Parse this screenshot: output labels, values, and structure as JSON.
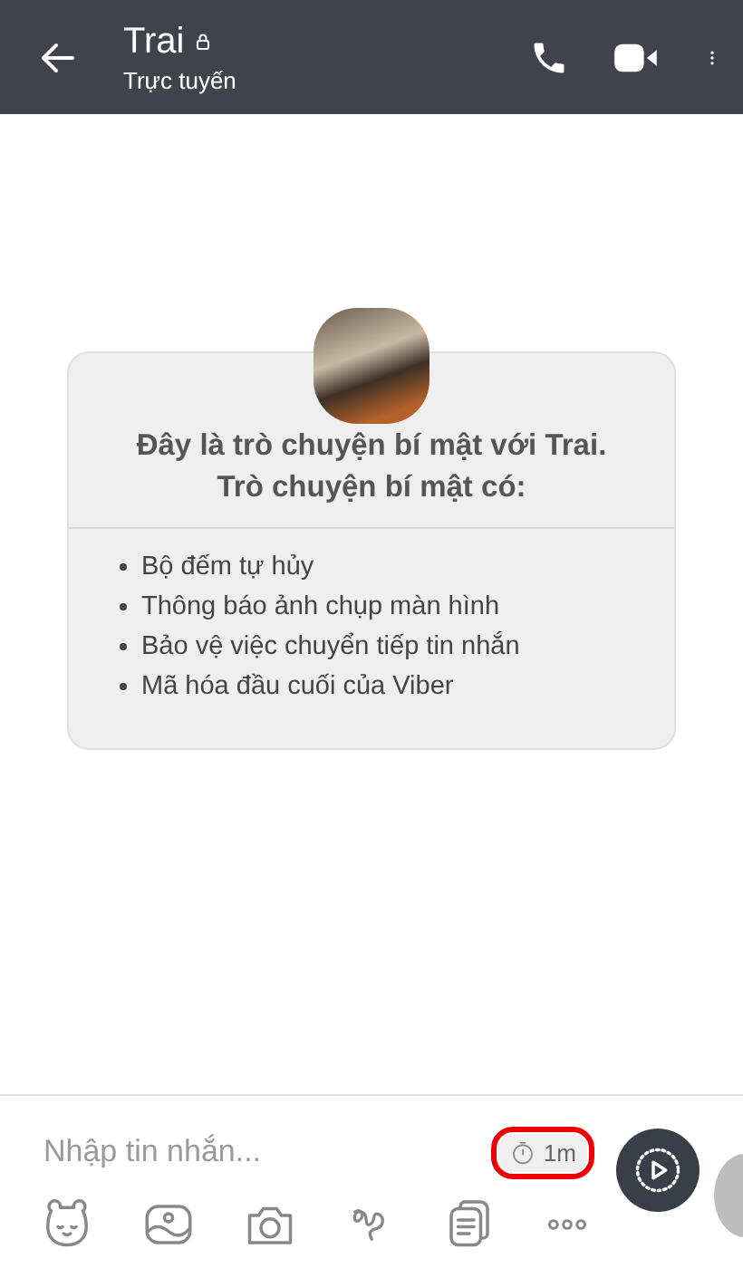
{
  "header": {
    "title": "Trai",
    "status": "Trực tuyến"
  },
  "intro": {
    "heading": "Đây là trò chuyện bí mật với Trai.\nTrò chuyện bí mật có:",
    "features": [
      "Bộ đếm tự hủy",
      "Thông báo ảnh chụp màn hình",
      "Bảo vệ việc chuyển tiếp tin nhắn",
      "Mã hóa đầu cuối của Viber"
    ]
  },
  "composer": {
    "placeholder": "Nhập tin nhắn...",
    "timer": "1m"
  }
}
